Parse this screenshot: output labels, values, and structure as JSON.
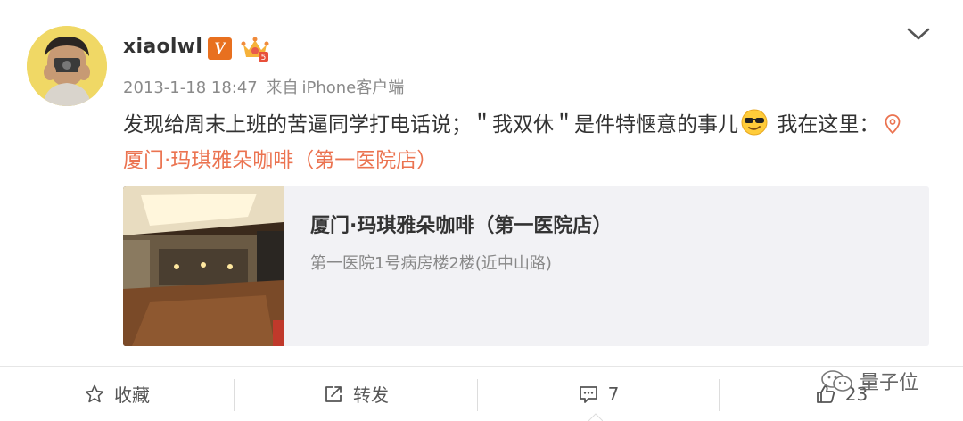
{
  "post": {
    "username": "xiaolwl",
    "vip_badge": "V",
    "timestamp": "2013-1-18 18:47",
    "source_prefix": "来自",
    "source": "iPhone客户端",
    "text_part1": "发现给周末上班的苦逼同学打电话说；＂我双休＂是件特惬意的事儿",
    "text_part2": "我在这里：",
    "location_link": "厦门·玛琪雅朵咖啡（第一医院店）",
    "icons": [
      "avatar",
      "verified-v-badge",
      "crown-badge",
      "chevron-down-icon",
      "sunglasses-emoji",
      "location-pin-icon"
    ]
  },
  "card": {
    "title": "厦门·玛琪雅朵咖啡（第一医院店）",
    "subtitle": "第一医院1号病房楼2楼(近中山路)"
  },
  "actions": {
    "favorite_label": "收藏",
    "repost_label": "转发",
    "comment_count": "7",
    "like_count": "23"
  },
  "watermark": {
    "text": "量子位"
  },
  "colors": {
    "link": "#eb7350",
    "badge_orange": "#e8701f",
    "meta_gray": "#8a8a8a",
    "card_bg": "#f2f2f5"
  }
}
